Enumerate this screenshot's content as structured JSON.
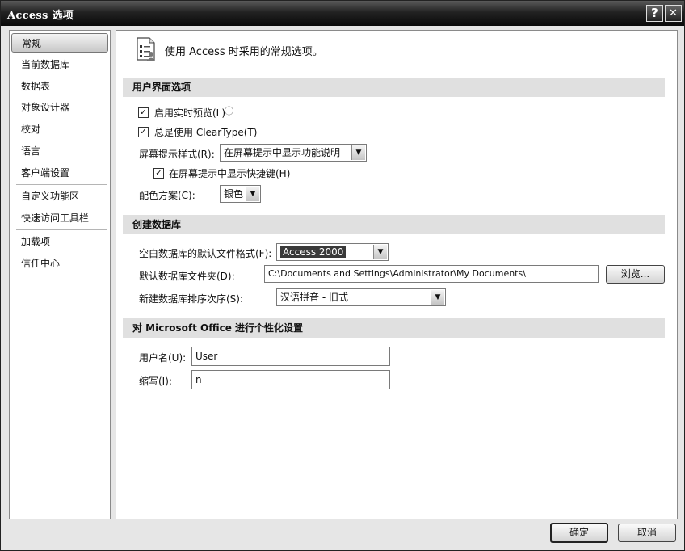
{
  "window": {
    "title": "Access 选项",
    "help_glyph": "?",
    "close_glyph": "✕"
  },
  "sidebar": {
    "items": [
      {
        "label": "常规",
        "selected": true
      },
      {
        "label": "当前数据库"
      },
      {
        "label": "数据表"
      },
      {
        "label": "对象设计器"
      },
      {
        "label": "校对"
      },
      {
        "label": "语言"
      },
      {
        "label": "客户端设置"
      },
      {
        "label": "自定义功能区"
      },
      {
        "label": "快速访问工具栏"
      },
      {
        "label": "加载项"
      },
      {
        "label": "信任中心"
      }
    ]
  },
  "header": {
    "text": "使用 Access 时采用的常规选项。",
    "icon": "options-icon"
  },
  "ui_options": {
    "section_title": "用户界面选项",
    "live_preview": {
      "label": "启用实时预览(L)",
      "checked": true,
      "info_glyph": "ⓘ"
    },
    "cleartype": {
      "label": "总是使用 ClearType(T)",
      "checked": true
    },
    "screentip_style": {
      "label": "屏幕提示样式(R):",
      "value": "在屏幕提示中显示功能说明"
    },
    "show_shortcut": {
      "label": "在屏幕提示中显示快捷键(H)",
      "checked": true
    },
    "color_scheme": {
      "label": "配色方案(C):",
      "value": "银色"
    }
  },
  "create_db": {
    "section_title": "创建数据库",
    "default_format": {
      "label": "空白数据库的默认文件格式(F):",
      "value": "Access 2000"
    },
    "default_folder": {
      "label": "默认数据库文件夹(D):",
      "value": "C:\\Documents and Settings\\Administrator\\My Documents\\"
    },
    "browse_label": "浏览...",
    "sort_order": {
      "label": "新建数据库排序次序(S):",
      "value": "汉语拼音 - 旧式"
    }
  },
  "personalize": {
    "section_title": "对 Microsoft Office 进行个性化设置",
    "username": {
      "label": "用户名(U):",
      "value": "User"
    },
    "initials": {
      "label": "缩写(I):",
      "value": "n"
    }
  },
  "footer": {
    "ok_label": "确定",
    "cancel_label": "取消"
  },
  "colors": {
    "titlebar": "#1a1a1a",
    "section_bg": "#e0e0e0",
    "window_bg": "#e6e6e6",
    "selection": "#3a3a3a"
  },
  "check_glyph": "✓",
  "dropdown_glyph": "▼"
}
